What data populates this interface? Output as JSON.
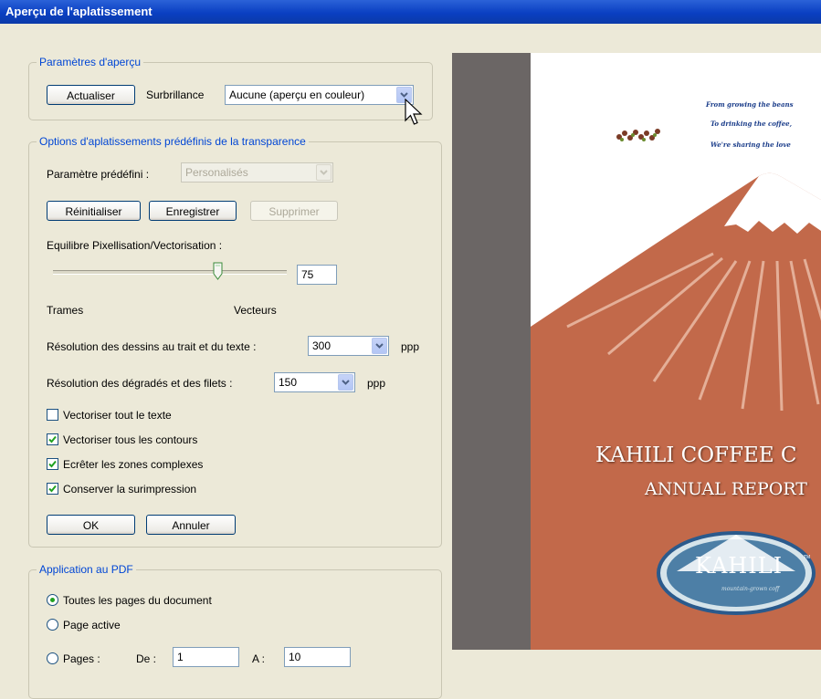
{
  "window": {
    "title": "Aperçu de l'aplatissement"
  },
  "preview_settings": {
    "legend": "Paramètres d'aperçu",
    "refresh_label": "Actualiser",
    "highlight_label": "Surbrillance",
    "highlight_value": "Aucune (aperçu en couleur)"
  },
  "presets": {
    "legend": "Options d'aplatissements prédéfinis de la transparence",
    "preset_label": "Paramètre prédéfini :",
    "preset_value": "Personalisés",
    "reset_label": "Réinitialiser",
    "save_label": "Enregistrer",
    "delete_label": "Supprimer",
    "balance_label": "Equilibre Pixellisation/Vectorisation :",
    "balance_value": "75",
    "balance_fraction": 0.75,
    "rasters_label": "Trames",
    "vectors_label": "Vecteurs",
    "lineart_label": "Résolution des dessins au trait et du texte :",
    "lineart_value": "300",
    "lineart_unit": "ppp",
    "gradient_label": "Résolution des dégradés et des filets :",
    "gradient_value": "150",
    "gradient_unit": "ppp",
    "checkboxes": [
      {
        "label": "Vectoriser tout le texte",
        "checked": false
      },
      {
        "label": "Vectoriser tous les contours",
        "checked": true
      },
      {
        "label": "Ecrêter les zones complexes",
        "checked": true
      },
      {
        "label": "Conserver la surimpression",
        "checked": true
      }
    ],
    "ok_label": "OK",
    "cancel_label": "Annuler"
  },
  "apply_to_pdf": {
    "legend": "Application au PDF",
    "all_pages_label": "Toutes les pages du document",
    "active_page_label": "Page active",
    "pages_label": "Pages :",
    "from_label": "De :",
    "from_value": "1",
    "to_label": "A :",
    "to_value": "10",
    "selected": "all_pages"
  },
  "preview": {
    "tagline_1": "From growing the beans",
    "tagline_2": "To drinking the coffee,",
    "tagline_3": "We're sharing the love",
    "cover_title": "KAHILI COFFEE C",
    "cover_subtitle": "ANNUAL REPORT",
    "logo_text": "KAHILI",
    "logo_tagline": "mountain-grown coff",
    "logo_tm": "TM"
  },
  "colors": {
    "title_bar": "#0a3fc2",
    "legend_text": "#0046d5",
    "mountain": "#c2694a",
    "preview_gray": "#6b6665",
    "tagline": "#1b3d8a",
    "check": "#21a121"
  },
  "icons": {
    "checkmark": "check-icon",
    "dropdown": "chevron-down-icon",
    "cursor": "mouse-pointer-icon"
  }
}
